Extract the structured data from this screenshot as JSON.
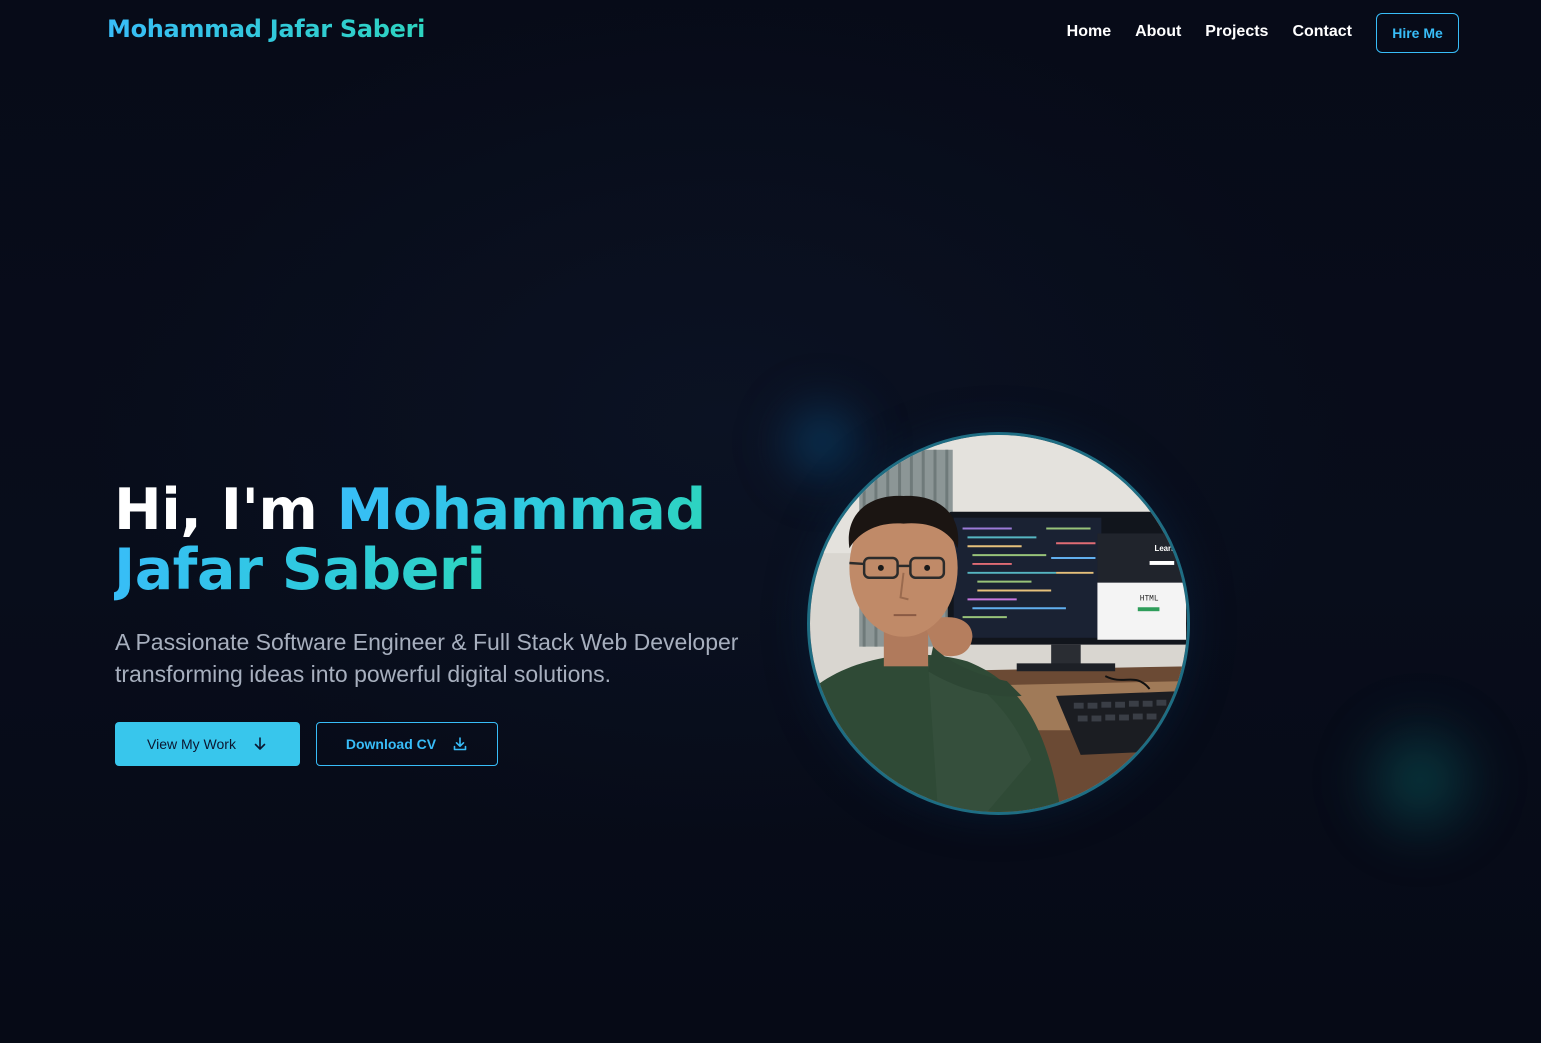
{
  "nav": {
    "logo": "Mohammad Jafar Saberi",
    "links": [
      {
        "label": "Home"
      },
      {
        "label": "About"
      },
      {
        "label": "Projects"
      },
      {
        "label": "Contact"
      }
    ],
    "hire_label": "Hire Me"
  },
  "hero": {
    "greeting": "Hi, I'm",
    "name_line1": "Mohammad",
    "name_line2": "Jafar Saberi",
    "subtitle": "A Passionate Software Engineer & Full Stack Web Developer transforming ideas into powerful digital solutions.",
    "primary_button": {
      "label": "View My Work",
      "icon": "arrow-down-icon"
    },
    "secondary_button": {
      "label": "Download CV",
      "icon": "download-icon"
    },
    "photo": {
      "screen_text_learn": "Learn",
      "screen_text_html": "HTML"
    }
  },
  "colors": {
    "background": "#070b18",
    "accent_blue": "#38bdf8",
    "accent_teal": "#2dd4bf",
    "primary_button": "#38c6ec",
    "subtitle": "#a7afbe"
  }
}
